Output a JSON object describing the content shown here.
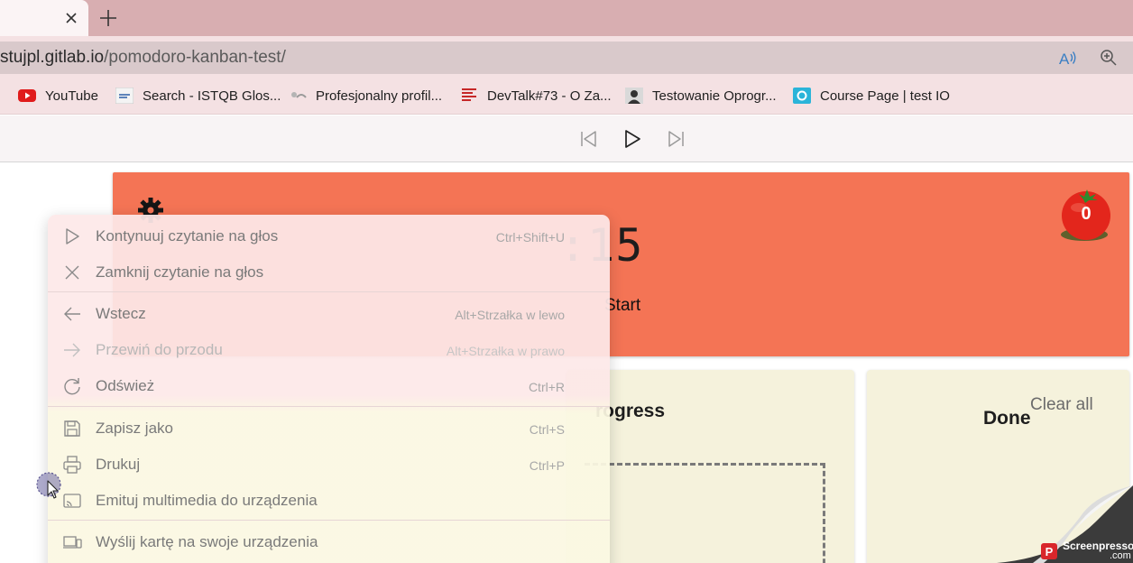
{
  "browser": {
    "new_tab_symbol": "+",
    "url_host": "stujpl.gitlab.io",
    "url_path": "/pomodoro-kanban-test/",
    "bookmarks": [
      {
        "label": "YouTube",
        "icon": "youtube-icon"
      },
      {
        "label": "Search - ISTQB Glos...",
        "icon": "istqb-icon"
      },
      {
        "label": "Profesjonalny profil...",
        "icon": "profile-icon"
      },
      {
        "label": "DevTalk#73 - O Za...",
        "icon": "devtalk-icon"
      },
      {
        "label": "Testowanie Oprogr...",
        "icon": "person-icon"
      },
      {
        "label": "Course Page | test IO",
        "icon": "testio-icon"
      }
    ],
    "icons": {
      "read_aloud": "read-aloud-icon",
      "zoom": "zoom-icon",
      "tab_close": "close-icon",
      "new_tab": "plus-icon"
    }
  },
  "reader_toolbar": {
    "icons": [
      "previous-paragraph-icon",
      "play-icon",
      "next-paragraph-icon"
    ]
  },
  "app": {
    "timer_visible": ":15",
    "start_label": "Start",
    "pomodoro_count": "0",
    "columns": {
      "progress_title_visible": "rogress",
      "done_title": "Done",
      "clear_all": "Clear all"
    }
  },
  "context_menu": {
    "items": [
      {
        "label": "Kontynuuj czytanie na głos",
        "shortcut": "Ctrl+Shift+U",
        "icon": "play-icon",
        "enabled": true
      },
      {
        "label": "Zamknij czytanie na głos",
        "shortcut": "",
        "icon": "close-icon",
        "enabled": true
      },
      {
        "label": "Wstecz",
        "shortcut": "Alt+Strzałka w lewo",
        "icon": "arrow-left-icon",
        "enabled": true
      },
      {
        "label": "Przewiń do przodu",
        "shortcut": "Alt+Strzałka w prawo",
        "icon": "arrow-right-icon",
        "enabled": false
      },
      {
        "label": "Odśwież",
        "shortcut": "Ctrl+R",
        "icon": "refresh-icon",
        "enabled": true
      },
      {
        "label": "Zapisz jako",
        "shortcut": "Ctrl+S",
        "icon": "save-icon",
        "enabled": true
      },
      {
        "label": "Drukuj",
        "shortcut": "Ctrl+P",
        "icon": "print-icon",
        "enabled": true
      },
      {
        "label": "Emituj multimedia do urządzenia",
        "shortcut": "",
        "icon": "cast-icon",
        "enabled": true
      },
      {
        "label": "Wyślij kartę na swoje urządzenia",
        "shortcut": "",
        "icon": "send-tab-icon",
        "enabled": true
      }
    ]
  },
  "watermark": {
    "text": "Screenpresso",
    "domain": ".com"
  },
  "colors": {
    "tabstrip": "#d8aeb1",
    "timer_panel": "#f47455",
    "column_bg": "#f5f2dc",
    "menu_bg_top": "#fde8e8",
    "menu_bg_bottom": "#fbf8e2"
  }
}
